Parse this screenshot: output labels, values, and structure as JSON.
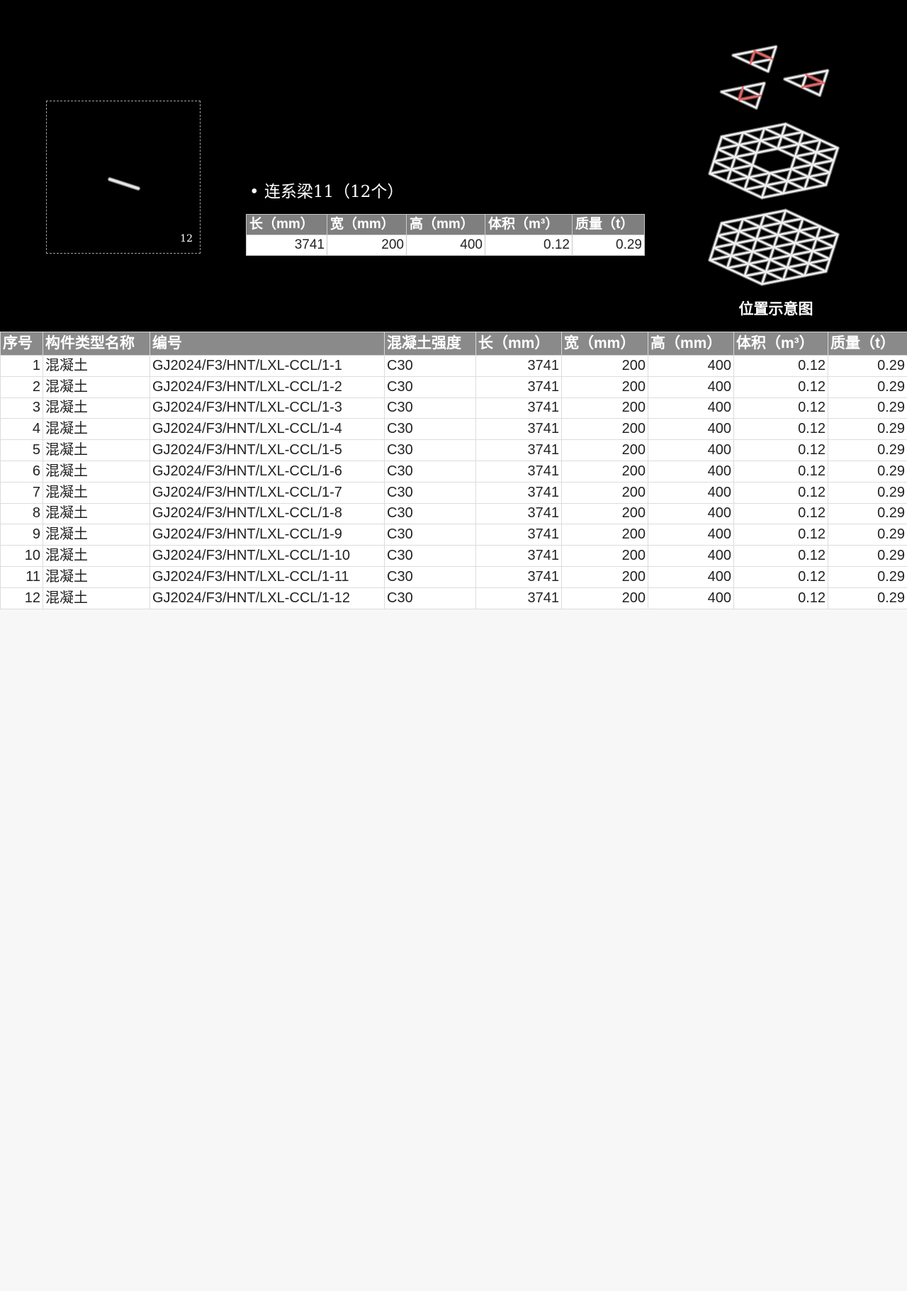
{
  "component": {
    "title": "• 连系梁11（12个）",
    "thumbnail_count": "12",
    "summary_headers": [
      "长（mm）",
      "宽（mm）",
      "高（mm）",
      "体积（m³）",
      "质量（t）"
    ],
    "summary_values": [
      "3741",
      "200",
      "400",
      "0.12",
      "0.29"
    ]
  },
  "diagram": {
    "caption": "位置示意图",
    "highlight_color": "#e06a6a"
  },
  "table": {
    "headers": [
      "序号",
      "构件类型名称",
      "编号",
      "混凝土强度",
      "长（mm）",
      "宽（mm）",
      "高（mm）",
      "体积（m³）",
      "质量（t）"
    ],
    "rows": [
      [
        "1",
        "混凝土",
        "GJ2024/F3/HNT/LXL-CCL/1-1",
        "C30",
        "3741",
        "200",
        "400",
        "0.12",
        "0.29"
      ],
      [
        "2",
        "混凝土",
        "GJ2024/F3/HNT/LXL-CCL/1-2",
        "C30",
        "3741",
        "200",
        "400",
        "0.12",
        "0.29"
      ],
      [
        "3",
        "混凝土",
        "GJ2024/F3/HNT/LXL-CCL/1-3",
        "C30",
        "3741",
        "200",
        "400",
        "0.12",
        "0.29"
      ],
      [
        "4",
        "混凝土",
        "GJ2024/F3/HNT/LXL-CCL/1-4",
        "C30",
        "3741",
        "200",
        "400",
        "0.12",
        "0.29"
      ],
      [
        "5",
        "混凝土",
        "GJ2024/F3/HNT/LXL-CCL/1-5",
        "C30",
        "3741",
        "200",
        "400",
        "0.12",
        "0.29"
      ],
      [
        "6",
        "混凝土",
        "GJ2024/F3/HNT/LXL-CCL/1-6",
        "C30",
        "3741",
        "200",
        "400",
        "0.12",
        "0.29"
      ],
      [
        "7",
        "混凝土",
        "GJ2024/F3/HNT/LXL-CCL/1-7",
        "C30",
        "3741",
        "200",
        "400",
        "0.12",
        "0.29"
      ],
      [
        "8",
        "混凝土",
        "GJ2024/F3/HNT/LXL-CCL/1-8",
        "C30",
        "3741",
        "200",
        "400",
        "0.12",
        "0.29"
      ],
      [
        "9",
        "混凝土",
        "GJ2024/F3/HNT/LXL-CCL/1-9",
        "C30",
        "3741",
        "200",
        "400",
        "0.12",
        "0.29"
      ],
      [
        "10",
        "混凝土",
        "GJ2024/F3/HNT/LXL-CCL/1-10",
        "C30",
        "3741",
        "200",
        "400",
        "0.12",
        "0.29"
      ],
      [
        "11",
        "混凝土",
        "GJ2024/F3/HNT/LXL-CCL/1-11",
        "C30",
        "3741",
        "200",
        "400",
        "0.12",
        "0.29"
      ],
      [
        "12",
        "混凝土",
        "GJ2024/F3/HNT/LXL-CCL/1-12",
        "C30",
        "3741",
        "200",
        "400",
        "0.12",
        "0.29"
      ]
    ]
  }
}
